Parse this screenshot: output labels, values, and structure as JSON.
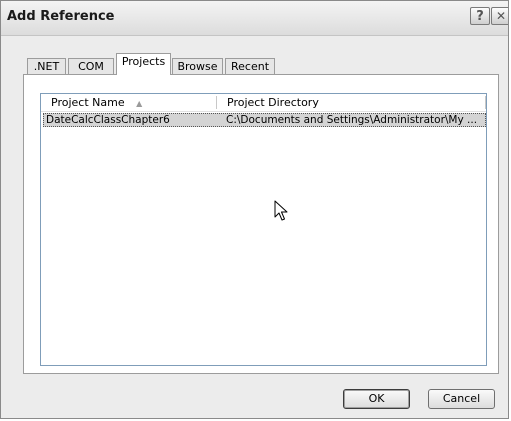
{
  "window": {
    "title": "Add Reference",
    "help_glyph": "?",
    "close_glyph": "✕"
  },
  "tabs": [
    {
      "label": ".NET"
    },
    {
      "label": "COM"
    },
    {
      "label": "Projects"
    },
    {
      "label": "Browse"
    },
    {
      "label": "Recent"
    }
  ],
  "active_tab": "Projects",
  "list": {
    "columns": [
      {
        "label": "Project Name",
        "sort": "ascending",
        "sort_glyph": "▲"
      },
      {
        "label": "Project Directory"
      }
    ],
    "rows": [
      {
        "name": "DateCalcClassChapter6",
        "directory": "C:\\Documents and Settings\\Administrator\\My ..."
      }
    ]
  },
  "buttons": {
    "ok": "OK",
    "cancel": "Cancel"
  },
  "icons": {
    "help": "help-icon",
    "close": "close-icon",
    "sort": "sort-ascending-icon",
    "cursor": "mouse-pointer-icon"
  }
}
